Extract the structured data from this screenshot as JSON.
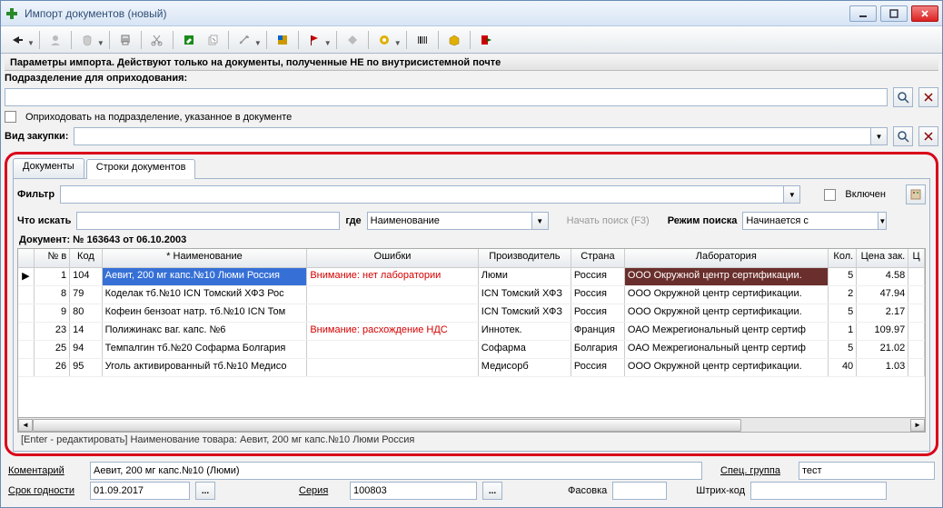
{
  "window": {
    "title": "Импорт документов (новый)"
  },
  "panel": {
    "params_caption": "Параметры импорта. Действуют только на документы, полученные НЕ по внутрисистемной почте",
    "division_label": "Подразделение для оприходования:",
    "division_value": "",
    "use_doc_division_label": "Оприходовать на подразделение, указанное в документе",
    "purchase_type_label": "Вид закупки:",
    "purchase_type_value": ""
  },
  "tabs": {
    "docs": "Документы",
    "lines": "Строки документов"
  },
  "filter": {
    "label": "Фильтр",
    "value": "",
    "enabled_label": "Включен"
  },
  "search": {
    "what_label": "Что искать",
    "what_value": "",
    "where_label": "где",
    "where_value": "Наименование",
    "start_label": "Начать поиск (F3)",
    "mode_label": "Режим поиска",
    "mode_value": "Начинается с"
  },
  "document_caption": "Документ: № 163643 от 06.10.2003",
  "grid": {
    "columns": {
      "num": "№ в",
      "kod": "Код",
      "name": "* Наименование",
      "err": "Ошибки",
      "prod": "Производитель",
      "country": "Страна",
      "lab": "Лаборатория",
      "kol": "Кол.",
      "price": "Цена зак.",
      "last": "Ц"
    },
    "rows": [
      {
        "num": "1",
        "kod": "104",
        "name": "Аевит, 200 мг капс.№10 Люми Россия",
        "err": "Внимание: нет лаборатории",
        "prod": "Люми",
        "country": "Россия",
        "lab": "ООО Окружной центр сертификации.",
        "kol": "5",
        "price": "4.58",
        "selected": true,
        "lab_hl": true
      },
      {
        "num": "8",
        "kod": "79",
        "name": "Коделак тб.№10 ICN Томский ХФЗ Рос",
        "err": "",
        "prod": "ICN Томский ХФЗ",
        "country": "Россия",
        "lab": "ООО Окружной центр сертификации.",
        "kol": "2",
        "price": "47.94"
      },
      {
        "num": "9",
        "kod": "80",
        "name": "Кофеин бензоат натр. тб.№10 ICN Том",
        "err": "",
        "prod": "ICN Томский ХФЗ",
        "country": "Россия",
        "lab": "ООО Окружной центр сертификации.",
        "kol": "5",
        "price": "2.17"
      },
      {
        "num": "23",
        "kod": "14",
        "name": "Полижинакс ваг. капс. №6",
        "err": "Внимание: расхождение НДС",
        "prod": "Иннотек.",
        "country": "Франция",
        "lab": "ОАО Межрегиональный центр сертиф",
        "kol": "1",
        "price": "109.97"
      },
      {
        "num": "25",
        "kod": "94",
        "name": "Темпалгин тб.№20 Софарма Болгария",
        "err": "",
        "prod": "Софарма",
        "country": "Болгария",
        "lab": "ОАО Межрегиональный центр сертиф",
        "kol": "5",
        "price": "21.02"
      },
      {
        "num": "26",
        "kod": "95",
        "name": "Уголь активированный тб.№10 Медисо",
        "err": "",
        "prod": "Медисорб",
        "country": "Россия",
        "lab": "ООО Окружной центр сертификации.",
        "kol": "40",
        "price": "1.03"
      }
    ]
  },
  "status_hint": "[Enter - редактировать] Наименование товара: Аевит, 200 мг капс.№10 Люми Россия",
  "bottom": {
    "comment_label": "Коментарий",
    "comment_value": "Аевит, 200 мг капс.№10 (Люми)",
    "spec_group_label": "Спец. группа",
    "spec_group_value": "тест",
    "expiry_label": "Срок годности",
    "expiry_value": "01.09.2017",
    "series_label": "Серия",
    "series_value": "100803",
    "pack_label": "Фасовка",
    "pack_value": "",
    "barcode_label": "Штрих-код",
    "barcode_value": ""
  }
}
